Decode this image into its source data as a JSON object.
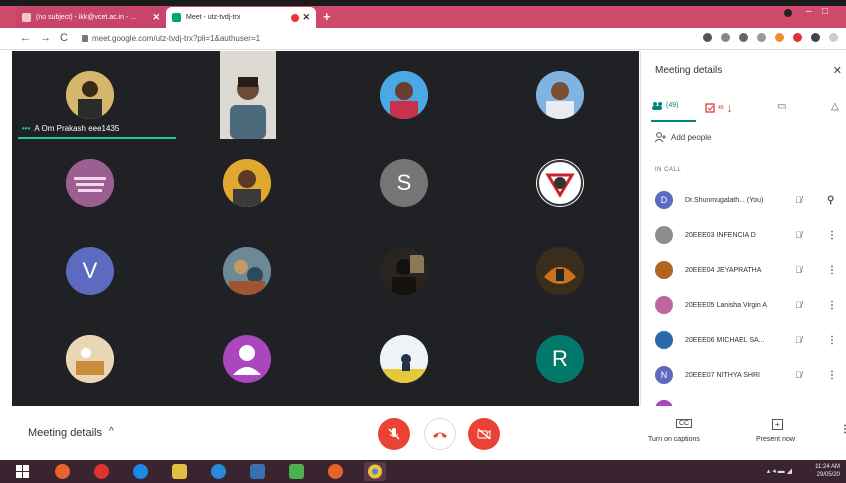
{
  "browser": {
    "tabs": [
      {
        "label": "(no subject) - ikk@vcet.ac.in - ...",
        "close": "✕"
      },
      {
        "label": "Meet - utz-tvdj-trx",
        "close": "✕"
      }
    ],
    "new_tab": "+",
    "url": "meet.google.com/utz-tvdj-trx?pli=1&authuser=1"
  },
  "grid": {
    "active_speaker_name": "A Om Prakash eee1435",
    "speaking_indicator": "•••",
    "letter_tiles": [
      "S",
      "V",
      "R"
    ]
  },
  "controls": {
    "meeting_details_label": "Meeting details",
    "caret": "^",
    "turn_on_captions": "Turn on captions",
    "present_now": "Present now",
    "cc_icon": "CC",
    "present_icon": "+"
  },
  "panel": {
    "title": "Meeting details",
    "close": "✕",
    "people_count": "(49)",
    "activity_count": "49",
    "add_people": "Add people",
    "in_call": "IN CALL",
    "participants": [
      {
        "name": "Dr.Shunmugalath...   (You)",
        "initial": "D",
        "color": "#5c6bc0"
      },
      {
        "name": "20EEE03 INFENCIA D",
        "initial": "",
        "color": "#8d8d8d"
      },
      {
        "name": "20EEE04 JEYAPRATHA",
        "initial": "",
        "color": "#b0661f"
      },
      {
        "name": "20EEE05 Lanisha Virgin A",
        "initial": "",
        "color": "#c066a0"
      },
      {
        "name": "20EEE06 MICHAEL SA...",
        "initial": "",
        "color": "#2b6aa8"
      },
      {
        "name": "20EEE07 NITHYA SHRI",
        "initial": "N",
        "color": "#5c6bc0"
      }
    ]
  },
  "taskbar": {
    "time": "11:24 AM",
    "date": "29/05/20"
  },
  "colors": {
    "meet_dark": "#202124",
    "end_call_red": "#ea4335",
    "teal_accent": "#00897b",
    "tabbar_pink": "#d04a6c"
  }
}
